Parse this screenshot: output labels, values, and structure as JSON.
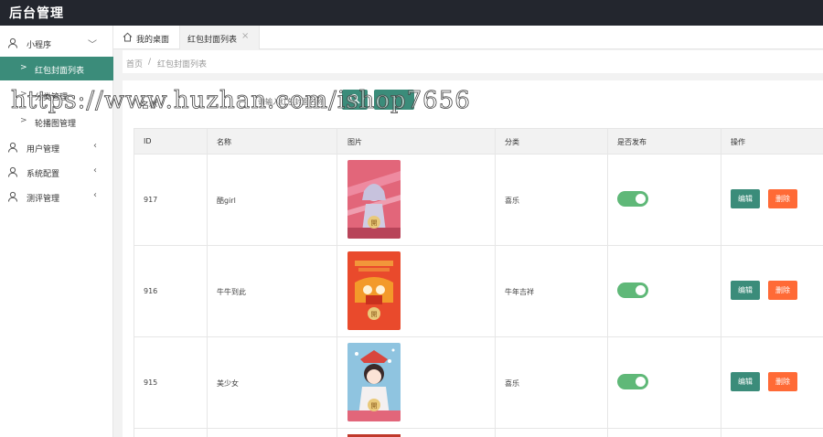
{
  "app": {
    "title": "后台管理"
  },
  "sidebar": {
    "items": [
      {
        "label": "小程序",
        "icon": "user-icon",
        "arrow": "﹀"
      },
      {
        "label": "用户管理",
        "icon": "user-icon",
        "arrow": "‹"
      },
      {
        "label": "系统配置",
        "icon": "user-icon",
        "arrow": "‹"
      },
      {
        "label": "测评管理",
        "icon": "user-icon",
        "arrow": "‹"
      }
    ],
    "subitems": [
      {
        "label": "红包封面列表",
        "arrow": ">"
      },
      {
        "label": "分类管理",
        "arrow": ">"
      },
      {
        "label": "轮播图管理",
        "arrow": ">"
      }
    ]
  },
  "tabs": {
    "home_label": "我的桌面",
    "active_label": "红包封面列表",
    "close_glyph": "×"
  },
  "breadcrumb": {
    "home": "首页",
    "separator": "/",
    "current": "红包封面列表"
  },
  "search": {
    "label": "名称",
    "placeholder": "请输入红包封面名称"
  },
  "table": {
    "headers": [
      "ID",
      "名称",
      "图片",
      "分类",
      "是否发布",
      "操作"
    ],
    "rows": [
      {
        "id": "917",
        "name": "酷girl",
        "category": "喜乐",
        "published": true
      },
      {
        "id": "916",
        "name": "牛牛到此",
        "category": "牛年吉祥",
        "published": true
      },
      {
        "id": "915",
        "name": "美少女",
        "category": "喜乐",
        "published": true
      }
    ],
    "edit_label": "编辑",
    "delete_label": "删除"
  },
  "watermark": "https://www.huzhan.com/ishop7656",
  "colors": {
    "topbar": "#23262e",
    "accent": "#3b8c7a",
    "switch_on": "#5fb878",
    "danger": "#ff6a36"
  }
}
